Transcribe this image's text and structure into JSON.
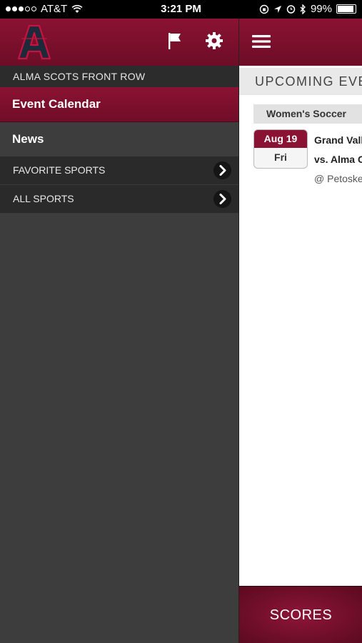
{
  "status_bar": {
    "carrier": "AT&T",
    "time": "3:21 PM",
    "battery": "99%",
    "signal_bars_filled": 3,
    "signal_bars_total": 5
  },
  "menu": {
    "section_title": "ALMA SCOTS FRONT ROW",
    "items": [
      {
        "label": "Event Calendar",
        "active": true
      },
      {
        "label": "News",
        "active": false
      }
    ],
    "sub_items": [
      {
        "label": "FAVORITE SPORTS"
      },
      {
        "label": "ALL SPORTS"
      }
    ]
  },
  "content": {
    "upcoming_label": "UPCOMING EVENTS",
    "sport": "Women's Soccer",
    "event": {
      "month_day": "Aug 19",
      "weekday": "Fri",
      "title": "Grand Valley",
      "opponent": "vs. Alma College",
      "location": "@ Petoskey"
    },
    "scores_button": "SCORES"
  },
  "icons": {
    "logo": "alma-a-logo",
    "flag": "flag-icon",
    "settings": "gear-icon",
    "menu": "hamburger-icon",
    "chevron": "chevron-right-icon"
  },
  "colors": {
    "brand_maroon": "#8a1232",
    "menu_bg": "#3d3d3d",
    "submenu_bg": "#2a2a2a"
  }
}
